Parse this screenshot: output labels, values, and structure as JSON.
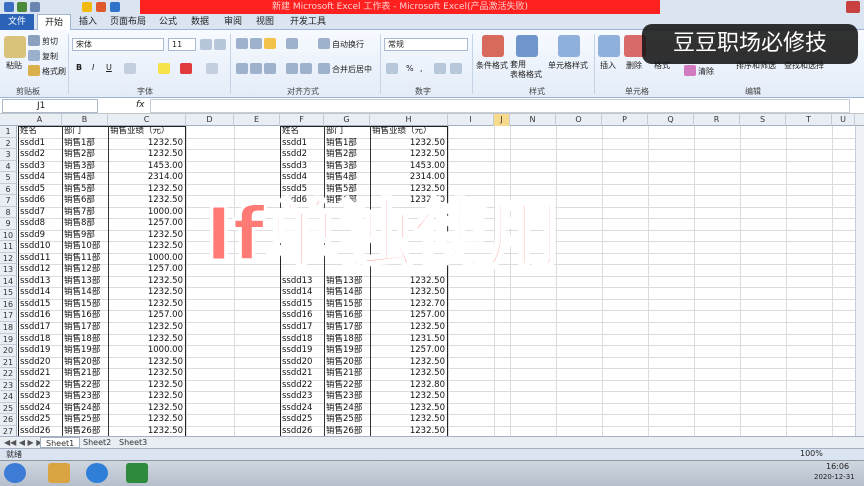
{
  "window": {
    "title": "新建 Microsoft Excel 工作表 - Microsoft Excel(产品激活失败)"
  },
  "ribbon_tabs": [
    {
      "label": "文件"
    },
    {
      "label": "开始"
    },
    {
      "label": "插入"
    },
    {
      "label": "页面布局"
    },
    {
      "label": "公式"
    },
    {
      "label": "数据"
    },
    {
      "label": "审阅"
    },
    {
      "label": "视图"
    },
    {
      "label": "开发工具"
    }
  ],
  "ribbon": {
    "paste": "粘贴",
    "cut": "剪切",
    "copy": "复制",
    "format_painter": "格式刷",
    "clipboard_group": "剪贴板",
    "font_name": "宋体",
    "font_size": "11",
    "bold": "B",
    "italic": "I",
    "underline": "U",
    "font_group": "字体",
    "wrap_text": "自动换行",
    "merge_center": "合并后居中",
    "alignment_group": "对齐方式",
    "number_format": "常规",
    "percent": "%",
    "comma": ",",
    "number_group": "数字",
    "conditional_format": "条件格式",
    "format_as_table": "套用\n表格格式",
    "cell_styles": "单元格样式",
    "styles_group": "样式",
    "insert": "插入",
    "delete": "删除",
    "format": "格式",
    "cells_group": "单元格",
    "clear": "清除",
    "sort_filter": "排序和筛选",
    "find_select": "查找和选择",
    "editing_group": "编辑"
  },
  "formula_bar": {
    "name_box": "J1",
    "fx": "fx",
    "formula": ""
  },
  "columns": [
    "A",
    "B",
    "C",
    "D",
    "E",
    "F",
    "G",
    "H",
    "I",
    "J",
    "N",
    "O",
    "P",
    "Q",
    "R",
    "S",
    "T",
    "U"
  ],
  "table_left": {
    "headers": [
      "姓名",
      "部门",
      "销售业绩（元）"
    ],
    "rows": [
      [
        "ssdd1",
        "销售1部",
        "1232.50"
      ],
      [
        "ssdd2",
        "销售2部",
        "1232.50"
      ],
      [
        "ssdd3",
        "销售3部",
        "1453.00"
      ],
      [
        "ssdd4",
        "销售4部",
        "2314.00"
      ],
      [
        "ssdd5",
        "销售5部",
        "1232.50"
      ],
      [
        "ssdd6",
        "销售6部",
        "1232.50"
      ],
      [
        "ssdd7",
        "销售7部",
        "1000.00"
      ],
      [
        "ssdd8",
        "销售8部",
        "1257.00"
      ],
      [
        "ssdd9",
        "销售9部",
        "1232.50"
      ],
      [
        "ssdd10",
        "销售10部",
        "1232.50"
      ],
      [
        "ssdd11",
        "销售11部",
        "1000.00"
      ],
      [
        "ssdd12",
        "销售12部",
        "1257.00"
      ],
      [
        "ssdd13",
        "销售13部",
        "1232.50"
      ],
      [
        "ssdd14",
        "销售14部",
        "1232.50"
      ],
      [
        "ssdd15",
        "销售15部",
        "1232.50"
      ],
      [
        "ssdd16",
        "销售16部",
        "1257.00"
      ],
      [
        "ssdd17",
        "销售17部",
        "1232.50"
      ],
      [
        "ssdd18",
        "销售18部",
        "1232.50"
      ],
      [
        "ssdd19",
        "销售19部",
        "1000.00"
      ],
      [
        "ssdd20",
        "销售20部",
        "1232.50"
      ],
      [
        "ssdd21",
        "销售21部",
        "1232.50"
      ],
      [
        "ssdd22",
        "销售22部",
        "1232.50"
      ],
      [
        "ssdd23",
        "销售23部",
        "1232.50"
      ],
      [
        "ssdd24",
        "销售24部",
        "1232.50"
      ],
      [
        "ssdd25",
        "销售25部",
        "1232.50"
      ],
      [
        "ssdd26",
        "销售26部",
        "1232.50"
      ]
    ]
  },
  "table_right": {
    "headers": [
      "姓名",
      "部门",
      "销售业绩（元）"
    ],
    "rows": [
      [
        "ssdd1",
        "销售1部",
        "1232.50"
      ],
      [
        "ssdd2",
        "销售2部",
        "1232.50"
      ],
      [
        "ssdd3",
        "销售3部",
        "1453.00"
      ],
      [
        "ssdd4",
        "销售4部",
        "2314.00"
      ],
      [
        "ssdd5",
        "销售5部",
        "1232.50"
      ],
      [
        "ssdd6",
        "销售6部",
        "1232.50"
      ],
      [
        "",
        "",
        ""
      ],
      [
        "",
        "",
        ""
      ],
      [
        "",
        "",
        ""
      ],
      [
        "",
        "",
        ""
      ],
      [
        "",
        "",
        ""
      ],
      [
        "",
        "",
        ""
      ],
      [
        "ssdd13",
        "销售13部",
        "1232.50"
      ],
      [
        "ssdd14",
        "销售14部",
        "1232.50"
      ],
      [
        "ssdd15",
        "销售15部",
        "1232.70"
      ],
      [
        "ssdd16",
        "销售16部",
        "1257.00"
      ],
      [
        "ssdd17",
        "销售17部",
        "1232.50"
      ],
      [
        "ssdd18",
        "销售18部",
        "1231.50"
      ],
      [
        "ssdd19",
        "销售19部",
        "1257.00"
      ],
      [
        "ssdd20",
        "销售20部",
        "1232.50"
      ],
      [
        "ssdd21",
        "销售21部",
        "1232.50"
      ],
      [
        "ssdd22",
        "销售22部",
        "1232.80"
      ],
      [
        "ssdd23",
        "销售23部",
        "1232.50"
      ],
      [
        "ssdd24",
        "销售24部",
        "1232.50"
      ],
      [
        "ssdd25",
        "销售25部",
        "1232.50"
      ],
      [
        "ssdd26",
        "销售26部",
        "1232.50"
      ]
    ]
  },
  "overlay_caption": "If单独使用",
  "watermark": "豆豆职场必修技",
  "sheet_tabs": [
    "Sheet1",
    "Sheet2",
    "Sheet3"
  ],
  "status": {
    "ready": "就绪",
    "zoom": "100%"
  },
  "taskbar": {
    "time": "16:06",
    "date": "2020-12-31"
  },
  "colors": {
    "title_red": "#ff2020",
    "file_tab": "#2a63b8",
    "overlay": "#ff7a74"
  }
}
